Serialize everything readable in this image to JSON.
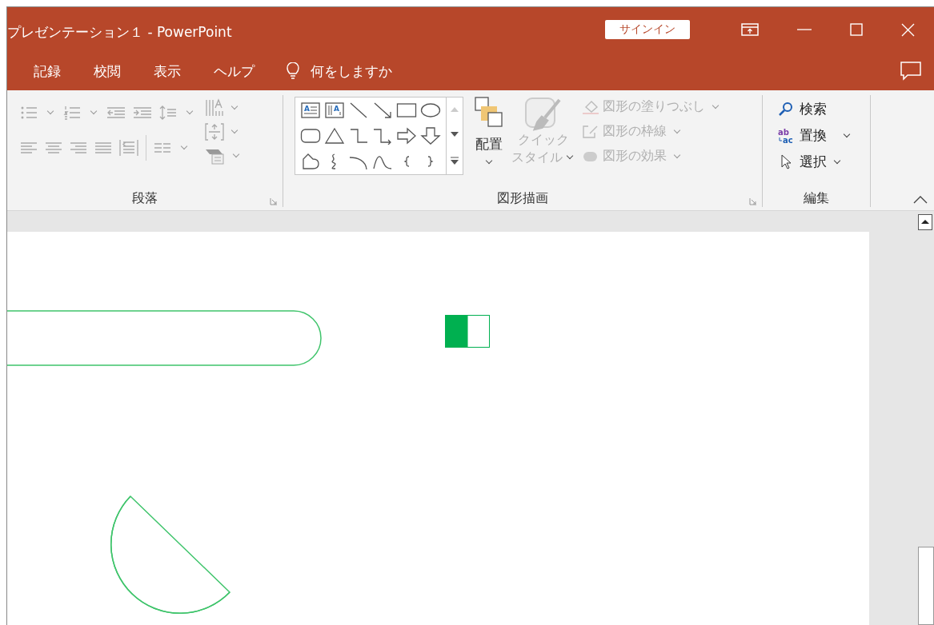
{
  "window": {
    "title": "プレゼンテーション１ - PowerPoint",
    "sign_in": "サインイン"
  },
  "tabs": [
    {
      "label": "記録"
    },
    {
      "label": "校閲"
    },
    {
      "label": "表示"
    },
    {
      "label": "ヘルプ"
    }
  ],
  "search": {
    "placeholder": "何をしますか"
  },
  "ribbon": {
    "groups": [
      {
        "kind": "paragraph",
        "label": "段落"
      },
      {
        "kind": "drawing",
        "label": "図形描画",
        "arrange": "配置",
        "gallery_glyphs": [
          "A",
          "A"
        ],
        "quick_style": {
          "line1": "クイック",
          "line2": "スタイル",
          "disabled": true
        },
        "commands": [
          {
            "label": "図形の塗りつぶし",
            "disabled": true
          },
          {
            "label": "図形の枠線",
            "disabled": true
          },
          {
            "label": "図形の効果",
            "disabled": true
          }
        ]
      },
      {
        "kind": "editing",
        "label": "編集",
        "commands": [
          {
            "label": "検索",
            "dropdown": false
          },
          {
            "label": "置換",
            "dropdown": true,
            "icon_text": [
              "ab",
              "ac"
            ]
          },
          {
            "label": "選択",
            "dropdown": true
          }
        ]
      }
    ]
  }
}
